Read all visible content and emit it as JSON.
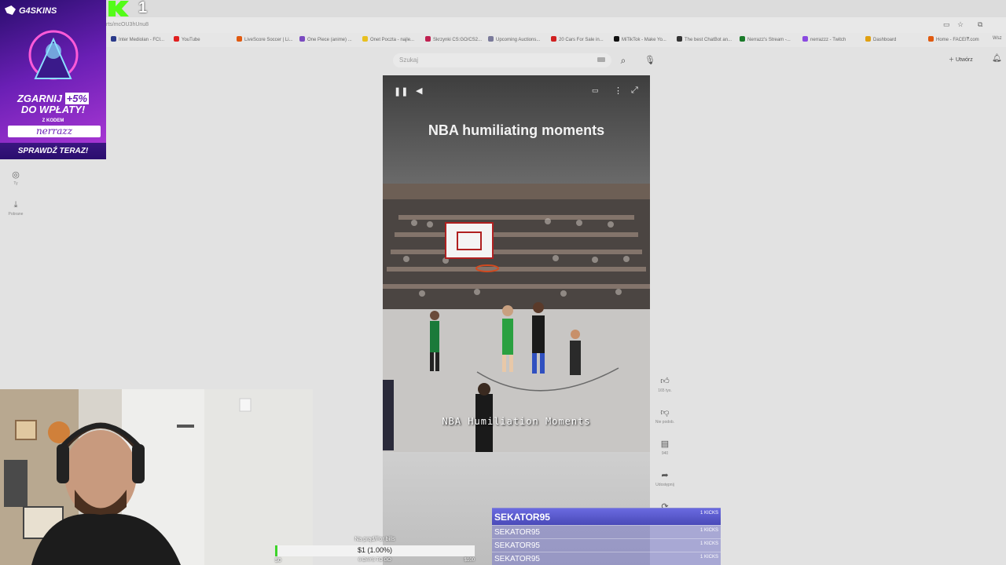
{
  "browser": {
    "url_fragment": "rts/mcOU3hUnu8",
    "bookmarks": [
      {
        "label": "Inter Mediolan - FCI...",
        "color": "#2a3a8a"
      },
      {
        "label": "YouTube",
        "color": "#e02020"
      },
      {
        "label": "LiveScore Soccer | Li...",
        "color": "#e05a10"
      },
      {
        "label": "One Piece (anime) ...",
        "color": "#7a4ac0"
      },
      {
        "label": "Onet Poczta - najle...",
        "color": "#e8c020"
      },
      {
        "label": "Skrzynki CS:GO/CS2...",
        "color": "#c02050"
      },
      {
        "label": "Upcoming Auctions...",
        "color": "#7a7a9a"
      },
      {
        "label": "20 Cars For Sale in...",
        "color": "#d02020"
      },
      {
        "label": "MiTikTok - Make Yo...",
        "color": "#111111"
      },
      {
        "label": "The best ChatBot an...",
        "color": "#333333"
      },
      {
        "label": "Nerrazz's Stream -...",
        "color": "#1a7a2a"
      },
      {
        "label": "nerrazzz - Twitch",
        "color": "#8a4ae0"
      },
      {
        "label": "Dashboard",
        "color": "#e0a010"
      },
      {
        "label": "Home - FACEIT.com",
        "color": "#e05a10"
      }
    ],
    "bookmarks_more": "»",
    "bookmarks_extra": "Wsz"
  },
  "header": {
    "search_placeholder": "Szukaj",
    "create_label": "Utwórz"
  },
  "sidebar": {
    "items": [
      {
        "label": "Ty",
        "icon": "user-icon"
      },
      {
        "label": "Pobrane",
        "icon": "download-icon"
      }
    ]
  },
  "video": {
    "title": "NBA humiliating moments",
    "caption": "NBA Humiliation Moments"
  },
  "actions": {
    "likes": "165 tys.",
    "dislike": "Nie podob.",
    "comments": "940",
    "share": "Udostępnij"
  },
  "banner": {
    "brand": "G4SKINS",
    "line1_text": "ZGARNIJ",
    "line1_pct": "+5%",
    "line2": "DO WPŁATY!",
    "code_label": "Z KODEM",
    "code": "nerrazz",
    "cta": "SPRAWDŹ TERAZ!"
  },
  "kick": {
    "count": "1",
    "brand_color": "#53fc18"
  },
  "goal": {
    "label": "Na prąd/For bills",
    "amount": "$1 (1.00%)",
    "progress": 0.01,
    "min": "$0",
    "days": "6 DAYS TO GO",
    "max": "$100"
  },
  "subs": [
    {
      "name": "SEKATOR95",
      "kicks": "1 KICKS"
    },
    {
      "name": "SEKATOR95",
      "kicks": "1 KICKS"
    },
    {
      "name": "SEKATOR95",
      "kicks": "1 KICKS"
    },
    {
      "name": "SEKATOR95",
      "kicks": "1 KICKS"
    }
  ]
}
